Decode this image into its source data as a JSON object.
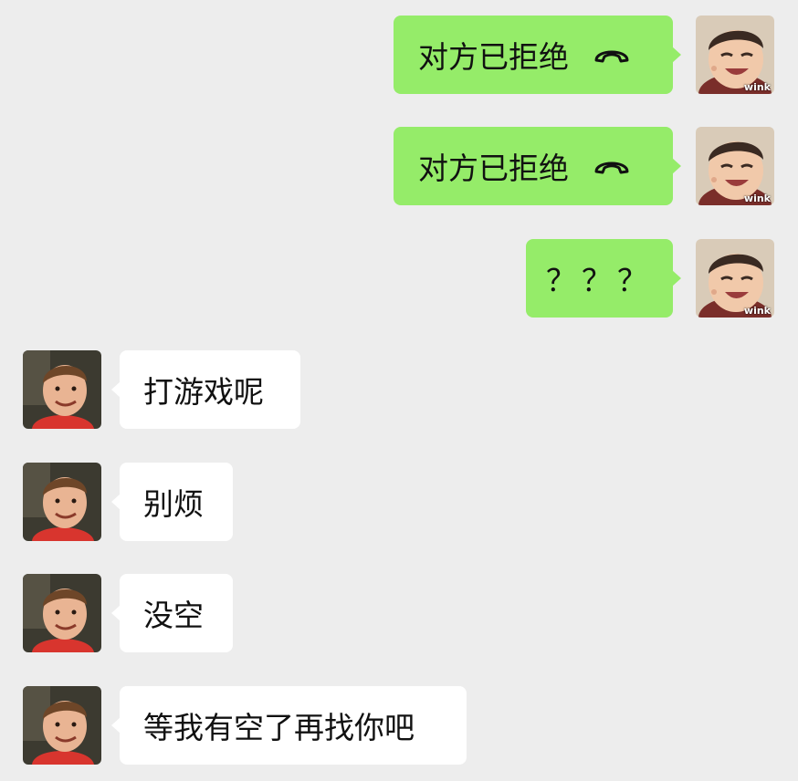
{
  "colors": {
    "background": "#ededed",
    "outgoing_bubble": "#95ec69",
    "incoming_bubble": "#ffffff"
  },
  "avatars": {
    "self": {
      "icon": "baby-laughing-avatar",
      "caption": "wink"
    },
    "contact": {
      "icon": "boy-smiling-avatar"
    }
  },
  "messages": [
    {
      "side": "out",
      "text": "对方已拒绝",
      "icon": "phone-hangup-icon"
    },
    {
      "side": "out",
      "text": "对方已拒绝",
      "icon": "phone-hangup-icon"
    },
    {
      "side": "out",
      "text": "？？？"
    },
    {
      "side": "in",
      "text": "打游戏呢"
    },
    {
      "side": "in",
      "text": "别烦"
    },
    {
      "side": "in",
      "text": "没空"
    },
    {
      "side": "in",
      "text": "等我有空了再找你吧"
    }
  ]
}
